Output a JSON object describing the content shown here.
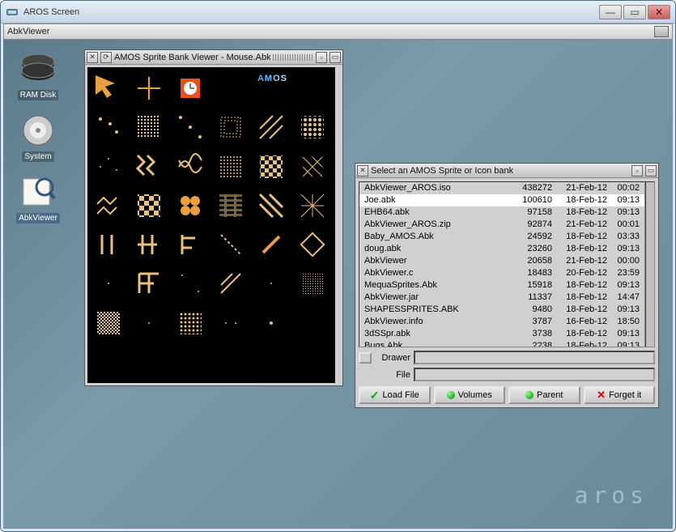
{
  "outer_window": {
    "title": "AROS Screen"
  },
  "menubar": {
    "label": "AbkViewer"
  },
  "desktop_icons": [
    {
      "name": "RAM Disk"
    },
    {
      "name": "System"
    },
    {
      "name": "AbkViewer"
    }
  ],
  "sprite_window": {
    "title": "AMOS Sprite Bank Viewer - Mouse.Abk",
    "logo": "AMOS"
  },
  "file_window": {
    "title": "Select an AMOS Sprite or Icon bank",
    "files": [
      {
        "name": "AbkViewer_AROS.iso",
        "size": "438272",
        "date": "21-Feb-12",
        "time": "00:02"
      },
      {
        "name": "Joe.abk",
        "size": "100610",
        "date": "18-Feb-12",
        "time": "09:13"
      },
      {
        "name": "EHB64.abk",
        "size": "97158",
        "date": "18-Feb-12",
        "time": "09:13"
      },
      {
        "name": "AbkViewer_AROS.zip",
        "size": "92874",
        "date": "21-Feb-12",
        "time": "00:01"
      },
      {
        "name": "Baby_AMOS.Abk",
        "size": "24592",
        "date": "18-Feb-12",
        "time": "03:33"
      },
      {
        "name": "doug.abk",
        "size": "23260",
        "date": "18-Feb-12",
        "time": "09:13"
      },
      {
        "name": "AbkViewer",
        "size": "20658",
        "date": "21-Feb-12",
        "time": "00:00"
      },
      {
        "name": "AbkViewer.c",
        "size": "18483",
        "date": "20-Feb-12",
        "time": "23:59"
      },
      {
        "name": "MequaSprites.Abk",
        "size": "15918",
        "date": "18-Feb-12",
        "time": "09:13"
      },
      {
        "name": "AbkViewer.jar",
        "size": "11337",
        "date": "18-Feb-12",
        "time": "14:47"
      },
      {
        "name": "SHAPESSPRITES.ABK",
        "size": "9480",
        "date": "18-Feb-12",
        "time": "09:13"
      },
      {
        "name": "AbkViewer.info",
        "size": "3787",
        "date": "16-Feb-12",
        "time": "18:50"
      },
      {
        "name": "3dSSpr.abk",
        "size": "3738",
        "date": "18-Feb-12",
        "time": "09:13"
      },
      {
        "name": "Bugs.Abk",
        "size": "2238",
        "date": "18-Feb-12",
        "time": "09:13"
      }
    ],
    "drawer_label": "Drawer",
    "file_label": "File",
    "buttons": {
      "load": "Load File",
      "volumes": "Volumes",
      "parent": "Parent",
      "forget": "Forget it"
    }
  },
  "brand": "aros"
}
